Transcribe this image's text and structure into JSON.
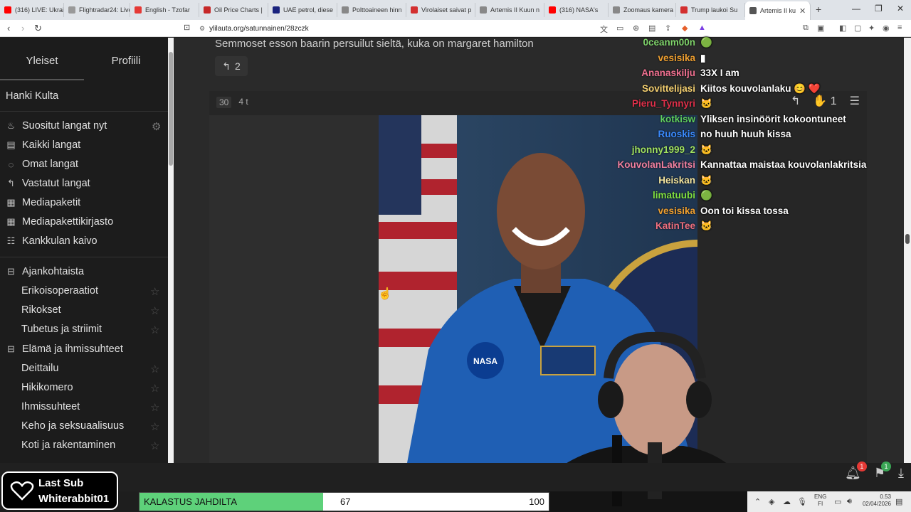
{
  "browser": {
    "tabs": [
      {
        "label": "(316) LIVE: Ukrain",
        "color": "#ff0000"
      },
      {
        "label": "Flightradar24: Live",
        "color": "#999999"
      },
      {
        "label": "English - Tzofar",
        "color": "#e53935"
      },
      {
        "label": "Oil Price Charts |",
        "color": "#c62828"
      },
      {
        "label": "UAE petrol, diese",
        "color": "#1a237e"
      },
      {
        "label": "Polttoaineen hinn",
        "color": "#888888"
      },
      {
        "label": "Virolaiset saivat p",
        "color": "#d32f2f"
      },
      {
        "label": "Artemis II Kuun n",
        "color": "#888888"
      },
      {
        "label": "(316) NASA's",
        "color": "#ff0000"
      },
      {
        "label": "Zoomaus kamera",
        "color": "#888888"
      },
      {
        "label": "Trump laukoi Su",
        "color": "#d32f2f"
      },
      {
        "label": "Artemis II ku",
        "color": "#555555"
      }
    ],
    "url": "ylilauta.org/satunnainen/28zczk"
  },
  "sidebar": {
    "tabs": [
      "Yleiset",
      "Profiili"
    ],
    "hanki": "Hanki Kulta",
    "nav_items": [
      {
        "label": "Suositut langat nyt",
        "icon": "flame-icon"
      },
      {
        "label": "Kaikki langat",
        "icon": "list-icon"
      },
      {
        "label": "Omat langat",
        "icon": "chat-icon"
      },
      {
        "label": "Vastatut langat",
        "icon": "reply-icon"
      },
      {
        "label": "Mediapaketit",
        "icon": "media-icon"
      },
      {
        "label": "Mediapakettikirjasto",
        "icon": "library-icon"
      },
      {
        "label": "Kankkulan kaivo",
        "icon": "well-icon"
      }
    ],
    "categories": [
      {
        "label": "Ajankohtaista",
        "items": [
          "Erikoisoperaatiot",
          "Rikokset",
          "Tubetus ja striimit"
        ]
      },
      {
        "label": "Elämä ja ihmissuhteet",
        "items": [
          "Deittailu",
          "Hikikomero",
          "Ihmissuhteet",
          "Keho ja seksuaalisuus",
          "Koti ja rakentaminen"
        ]
      }
    ]
  },
  "post": {
    "text": "Semmoset esson baarin persuilut sieltä, kuka on margaret hamilton",
    "reply_count": "2",
    "number": "30",
    "age": "4 t",
    "reactions": "1"
  },
  "chat": [
    {
      "user": "0ceanm00n",
      "color": "#7fd36b",
      "msg": "🟢"
    },
    {
      "user": "vesisika",
      "color": "#f0a030",
      "msg": "▮"
    },
    {
      "user": "Ananaskilju",
      "color": "#f07090",
      "msg": "33X I am"
    },
    {
      "user": "Sovittelijasi",
      "color": "#f5d070",
      "msg": "Kiitos kouvolanlaku 😊 ❤️"
    },
    {
      "user": "Pieru_Tynnyri",
      "color": "#e0304a",
      "msg": "🐱"
    },
    {
      "user": "kotkisw",
      "color": "#60d060",
      "msg": "Yliksen insinöörit kokoontuneet"
    },
    {
      "user": "Ruoskis",
      "color": "#3a8bff",
      "msg": "no huuh huuh kissa"
    },
    {
      "user": "jhonny1999_2",
      "color": "#a0e060",
      "msg": "🐱"
    },
    {
      "user": "KouvolanLakritsi",
      "color": "#f080a0",
      "msg": "Kannattaa maistaa kouvolanlakritsia"
    },
    {
      "user": "Heiskan",
      "color": "#f5e6a0",
      "msg": "🐱"
    },
    {
      "user": "limatuubi",
      "color": "#80e040",
      "msg": "🟢"
    },
    {
      "user": "vesisika",
      "color": "#f0a030",
      "msg": "Oon toi kissa tossa"
    },
    {
      "user": "KatinTee",
      "color": "#f07080",
      "msg": "🐱"
    }
  ],
  "overlay": {
    "lastsub_title": "Last Sub",
    "lastsub_name": "Whiterabbit01",
    "goal_label": "KALASTUS JAHDILTA",
    "goal_current": "67",
    "goal_max": "100",
    "goal_fraction": 0.67
  },
  "notifications": {
    "bell": "1",
    "bookmark": "1"
  },
  "taskbar": {
    "lang1": "ENG",
    "lang2": "FI",
    "time": "0.53",
    "date": "02/04/2026"
  }
}
